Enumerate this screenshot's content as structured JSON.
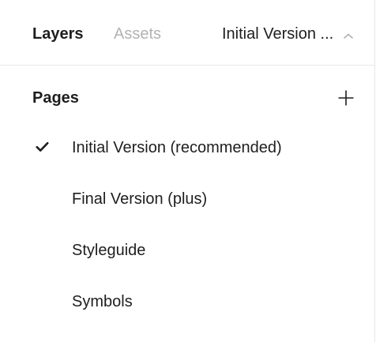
{
  "tabs": {
    "layers_label": "Layers",
    "assets_label": "Assets"
  },
  "page_selector": {
    "current_label": "Initial Version ...",
    "chevron_icon": "chevron-up-icon"
  },
  "pages_section": {
    "title": "Pages",
    "add_icon": "plus-icon",
    "items": [
      {
        "label": "Initial Version (recommended)",
        "selected": true
      },
      {
        "label": "Final Version (plus)",
        "selected": false
      },
      {
        "label": "Styleguide",
        "selected": false
      },
      {
        "label": "Symbols",
        "selected": false
      }
    ]
  },
  "colors": {
    "text_primary": "#1e1e1e",
    "text_muted": "#b3b3b3",
    "divider": "#e8e8e8",
    "background": "#ffffff"
  }
}
